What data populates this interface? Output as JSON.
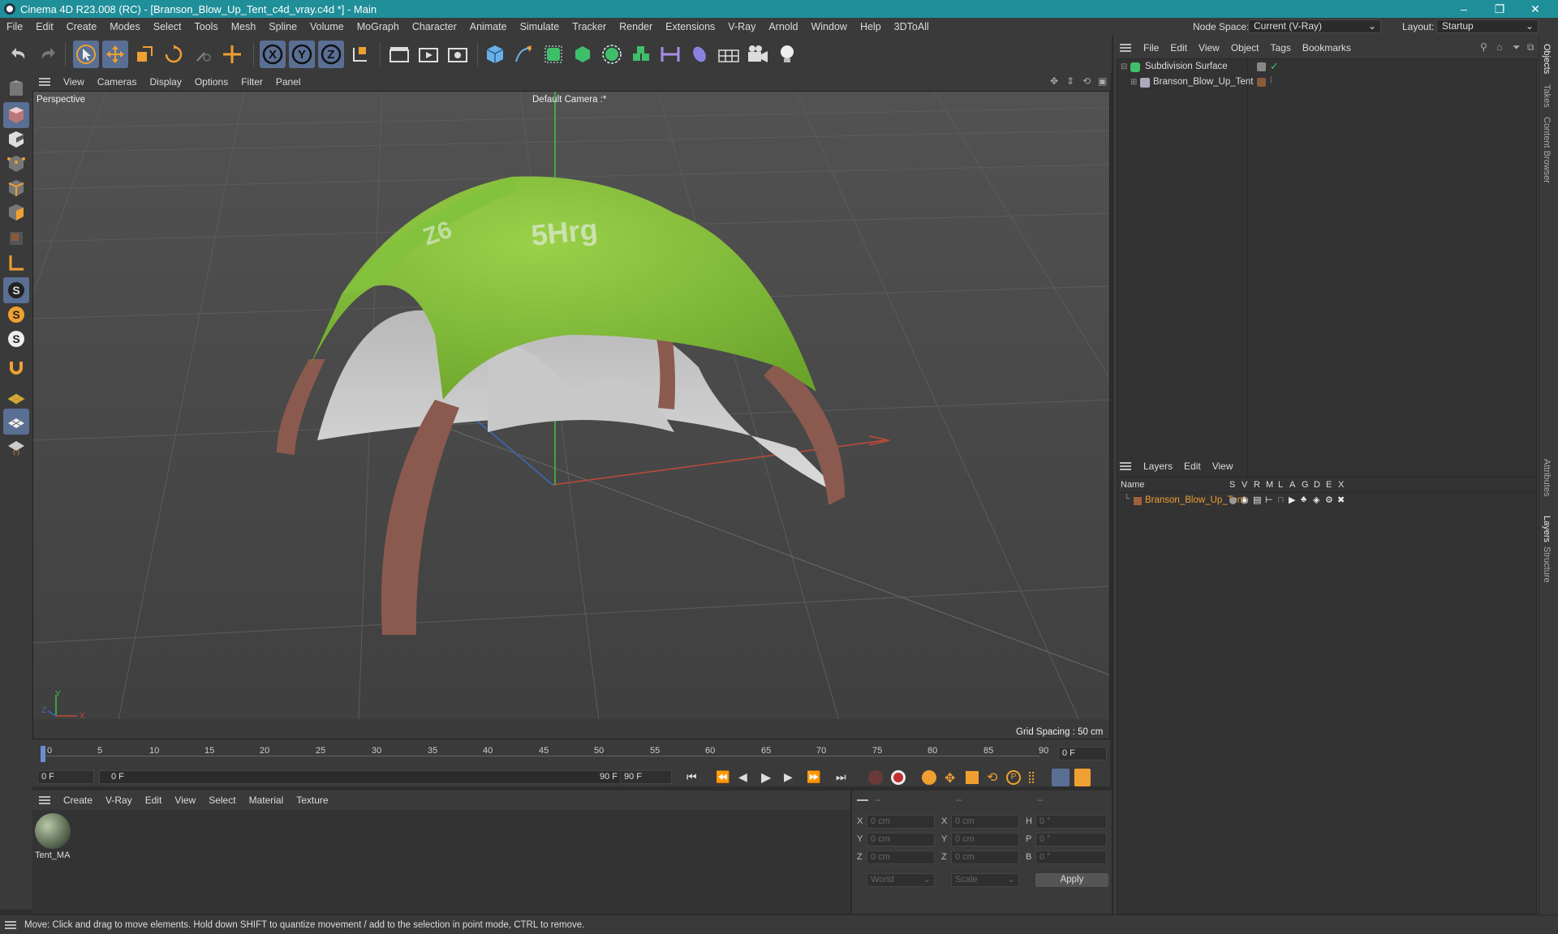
{
  "window": {
    "title": "Cinema 4D R23.008 (RC) - [Branson_Blow_Up_Tent_c4d_vray.c4d *] - Main",
    "minimize": "–",
    "restore": "❐",
    "close": "✕"
  },
  "menu": [
    "File",
    "Edit",
    "Create",
    "Modes",
    "Select",
    "Tools",
    "Mesh",
    "Spline",
    "Volume",
    "MoGraph",
    "Character",
    "Animate",
    "Simulate",
    "Tracker",
    "Render",
    "Extensions",
    "V-Ray",
    "Arnold",
    "Window",
    "Help",
    "3DToAll"
  ],
  "node_space": {
    "label": "Node Space:",
    "value": "Current (V-Ray)"
  },
  "layout": {
    "label": "Layout:",
    "value": "Startup"
  },
  "viewport": {
    "menu": [
      "View",
      "Cameras",
      "Display",
      "Options",
      "Filter",
      "Panel"
    ],
    "view_name": "Perspective",
    "camera": "Default Camera :*",
    "grid_spacing": "Grid Spacing : 50 cm",
    "axis_x": "X",
    "axis_y": "Y",
    "axis_z": "Z",
    "tent_text_1": "Z6",
    "tent_text_2": "5Hrg"
  },
  "timeline": {
    "ticks": [
      "0",
      "5",
      "10",
      "15",
      "20",
      "25",
      "30",
      "35",
      "40",
      "45",
      "50",
      "55",
      "60",
      "65",
      "70",
      "75",
      "80",
      "85",
      "90"
    ],
    "current_frame": "0 F"
  },
  "transport": {
    "start": "0 F",
    "range_start": "0 F",
    "range_end": "90 F",
    "end": "90 F"
  },
  "material_manager": {
    "menu": [
      "Create",
      "V-Ray",
      "Edit",
      "View",
      "Select",
      "Material",
      "Texture"
    ],
    "materials": [
      {
        "name": "Tent_MA"
      }
    ]
  },
  "coordinates": {
    "headers": [
      "--",
      "--",
      "--"
    ],
    "rows": [
      {
        "a": "X",
        "av": "0 cm",
        "b": "X",
        "bv": "0 cm",
        "c": "H",
        "cv": "0 °"
      },
      {
        "a": "Y",
        "av": "0 cm",
        "b": "Y",
        "bv": "0 cm",
        "c": "P",
        "cv": "0 °"
      },
      {
        "a": "Z",
        "av": "0 cm",
        "b": "Z",
        "bv": "0 cm",
        "c": "B",
        "cv": "0 °"
      }
    ],
    "space": "World",
    "mode": "Scale",
    "apply": "Apply"
  },
  "object_manager": {
    "menu": [
      "File",
      "Edit",
      "View",
      "Object",
      "Tags",
      "Bookmarks"
    ],
    "objects": [
      {
        "name": "Subdivision Surface"
      },
      {
        "name": "Branson_Blow_Up_Tent"
      }
    ]
  },
  "layer_manager": {
    "menu": [
      "Layers",
      "Edit",
      "View"
    ],
    "columns": [
      "Name",
      "S",
      "V",
      "R",
      "M",
      "L",
      "A",
      "G",
      "D",
      "E",
      "X"
    ],
    "layers": [
      {
        "name": "Branson_Blow_Up_Tent",
        "color": "#a0603c"
      }
    ]
  },
  "side_tabs": [
    "Objects",
    "Takes",
    "Content Browser",
    "Attributes",
    "Layers",
    "Structure"
  ],
  "status": "Move: Click and drag to move elements. Hold down SHIFT to quantize movement / add to the selection in point mode, CTRL to remove.",
  "colors": {
    "accent": "#1f8f9a",
    "selected": "#5a6f94",
    "orange": "#f0a030",
    "layer_text": "#f0a030"
  }
}
